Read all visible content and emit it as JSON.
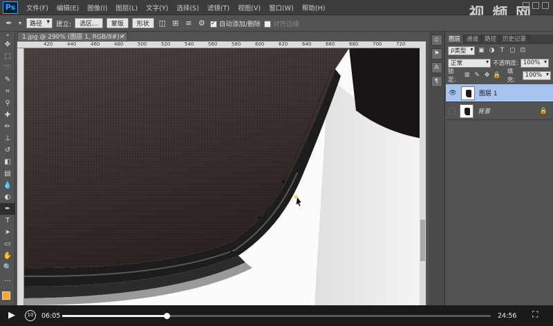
{
  "app": {
    "logo": "Ps",
    "menu": [
      "文件(F)",
      "编辑(E)",
      "图像(I)",
      "图层(L)",
      "文字(Y)",
      "选择(S)",
      "滤镜(T)",
      "视图(V)",
      "窗口(W)",
      "帮助(H)"
    ],
    "watermark": "视 频 网"
  },
  "options": {
    "mode_select": "路径",
    "make_label": "建立:",
    "selection_btn": "选区...",
    "mask_btn": "蒙版",
    "shape_btn": "形状",
    "auto_add_delete": "自动添加/删除",
    "align_edges": "对齐边缘"
  },
  "document": {
    "tab_title": "1.jpg @ 290% (图层 1, RGB/8#) *",
    "tab_close": "×",
    "ruler_ticks": [
      "420",
      "440",
      "460",
      "480",
      "500",
      "520",
      "540",
      "560",
      "580",
      "600",
      "620",
      "640",
      "660",
      "680",
      "700",
      "720"
    ]
  },
  "layers": {
    "tabs": [
      "图层",
      "通道",
      "路径",
      "历史记录"
    ],
    "filter_kind": "类型",
    "blend_mode": "正常",
    "opacity_label": "不透明度:",
    "opacity_value": "100%",
    "lock_label": "锁定:",
    "fill_label": "填充:",
    "fill_value": "100%",
    "items": [
      {
        "name": "图层 1",
        "visible": true,
        "selected": true
      },
      {
        "name": "背景",
        "visible": false,
        "locked": true
      }
    ]
  },
  "video": {
    "current_time": "06:05",
    "total_time": "24:56",
    "replay_label": "10",
    "progress": 0.244
  },
  "colors": {
    "foreground": "#f7a823",
    "background": "#ffffff",
    "selected_layer": "#a8c4ee"
  }
}
